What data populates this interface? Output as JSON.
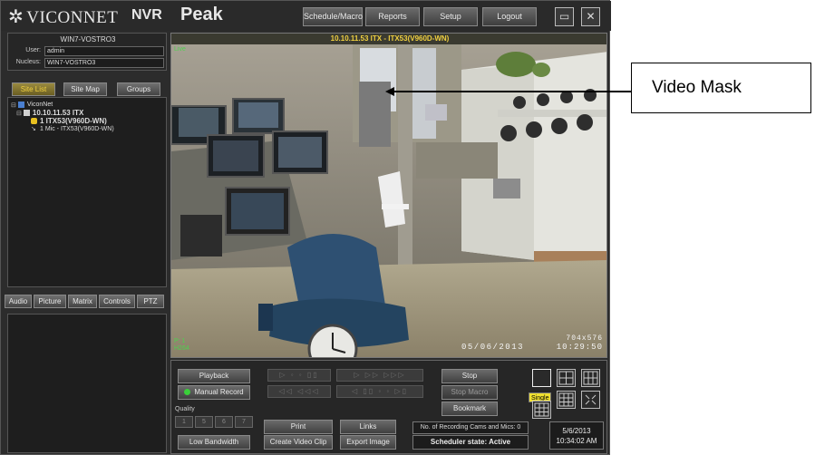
{
  "header": {
    "logo_text": "VICONNET",
    "product_prefix": "NVR",
    "product_name": "Peak",
    "buttons": [
      "Schedule/Macro",
      "Reports",
      "Setup",
      "Logout"
    ]
  },
  "info": {
    "host": "WIN7-VOSTRO3",
    "user_label": "User:",
    "user_value": "admin",
    "nucleus_label": "Nucleus:",
    "nucleus_value": "WIN7-VOSTRO3"
  },
  "site_tabs": [
    "Site List",
    "Site Map",
    "Groups"
  ],
  "tree": {
    "root": "ViconNet",
    "server": "10.10.11.53 ITX",
    "camera": "1  ITX53(V960D-WN)",
    "mic": "1  Mic - ITX53(V960D-WN)"
  },
  "bottom_tabs": [
    "Audio",
    "Picture",
    "Matrix",
    "Controls",
    "PTZ"
  ],
  "video": {
    "title": "10.10.11.53 ITX  -  ITX53(V960D-WN)",
    "live": "Live",
    "stream_line1": "P: 1",
    "stream_line2": "H264",
    "date": "05/06/2013",
    "resolution": "704x576",
    "time": "10:29:50"
  },
  "controls": {
    "playback": "Playback",
    "manual_record": "Manual Record",
    "quality_label": "Quality",
    "quality_options": [
      "1",
      "5",
      "6",
      "7"
    ],
    "low_bandwidth": "Low Bandwidth",
    "print": "Print",
    "links": "Links",
    "create_clip": "Create Video Clip",
    "export_image": "Export Image",
    "stop": "Stop",
    "stop_macro": "Stop Macro",
    "bookmark": "Bookmark",
    "recording_status": "No. of Recording Cams and Mics: 0",
    "scheduler_status": "Scheduler state: Active",
    "date": "5/6/2013",
    "time": "10:34:02 AM",
    "layout_tooltip": "Single"
  },
  "annotation": {
    "callout_text": "Video Mask"
  },
  "colors": {
    "accent_yellow": "#f0d040",
    "live_green": "#4fd04f"
  }
}
